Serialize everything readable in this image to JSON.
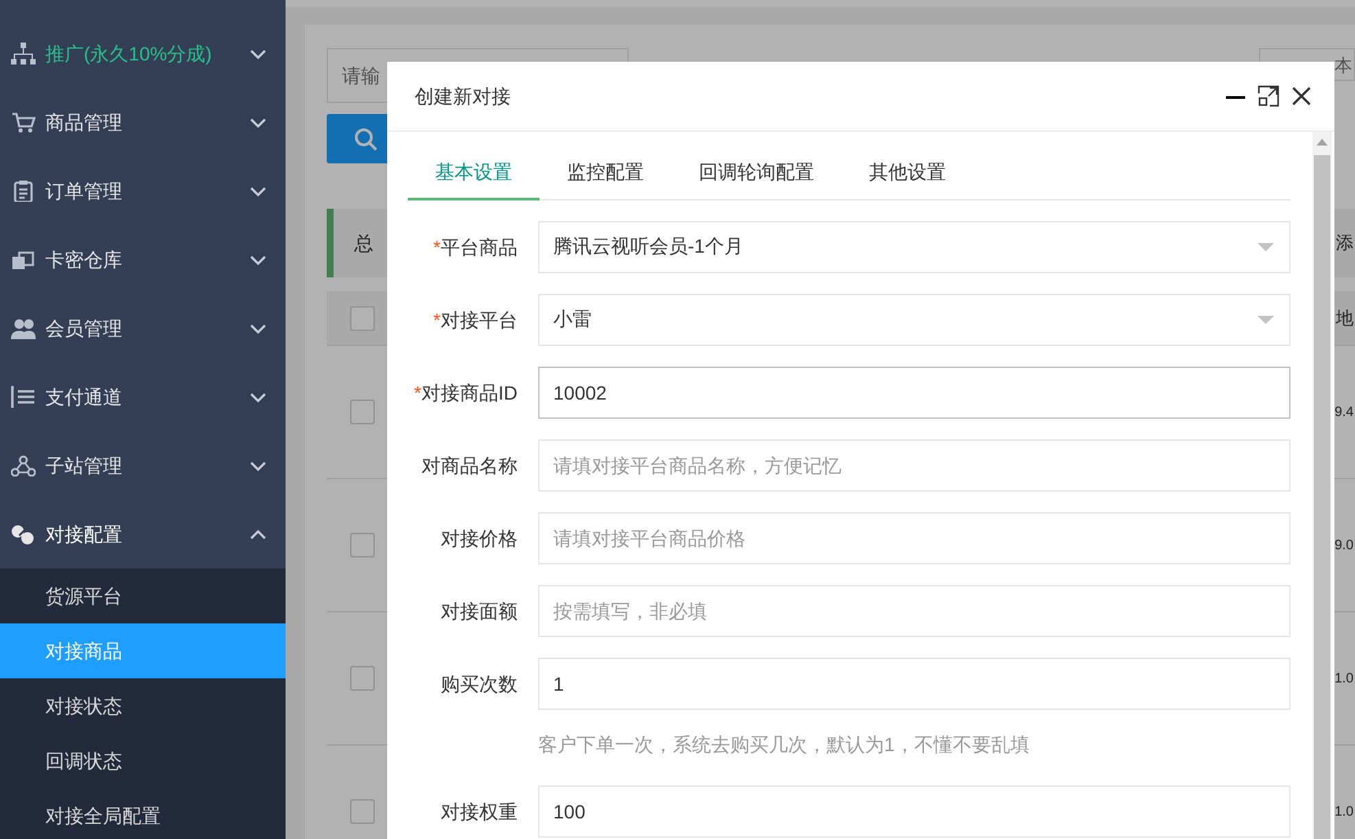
{
  "sidebar": {
    "items": [
      {
        "label": "推广(永久10%分成)",
        "kind": "promo",
        "expanded": false
      },
      {
        "label": "商品管理",
        "kind": "menu",
        "expanded": false
      },
      {
        "label": "订单管理",
        "kind": "menu",
        "expanded": false
      },
      {
        "label": "卡密仓库",
        "kind": "menu",
        "expanded": false
      },
      {
        "label": "会员管理",
        "kind": "menu",
        "expanded": false
      },
      {
        "label": "支付通道",
        "kind": "menu",
        "expanded": false
      },
      {
        "label": "子站管理",
        "kind": "menu",
        "expanded": false
      },
      {
        "label": "对接配置",
        "kind": "menu",
        "expanded": true,
        "children": [
          {
            "label": "货源平台",
            "selected": false
          },
          {
            "label": "对接商品",
            "selected": true
          },
          {
            "label": "对接状态",
            "selected": false
          },
          {
            "label": "回调状态",
            "selected": false
          },
          {
            "label": "对接全局配置",
            "selected": false
          }
        ]
      }
    ]
  },
  "background": {
    "search": {
      "placeholder": "请输"
    },
    "filter": {
      "placeholder": "本"
    },
    "notice": "总",
    "notice_right": "添",
    "table": {
      "header": {
        "checked": false,
        "text": "地"
      },
      "rows": [
        {
          "checked": false,
          "text": "9.4"
        },
        {
          "checked": false,
          "text": "9.0"
        },
        {
          "checked": false,
          "text": "1.0"
        },
        {
          "checked": false,
          "text": "1.0"
        }
      ]
    }
  },
  "modal": {
    "title": "创建新对接",
    "tabs": [
      {
        "label": "基本设置",
        "selected": true
      },
      {
        "label": "监控配置",
        "selected": false
      },
      {
        "label": "回调轮询配置",
        "selected": false
      },
      {
        "label": "其他设置",
        "selected": false
      }
    ],
    "fields": [
      {
        "label": "平台商品",
        "required_mark": "*",
        "kind": "select",
        "value": "腾讯云视听会员-1个月",
        "focused": false
      },
      {
        "label": "对接平台",
        "required_mark": "*",
        "kind": "select",
        "value": "小雷",
        "focused": false
      },
      {
        "label": "对接商品ID",
        "required_mark": "*",
        "kind": "input",
        "value": "10002",
        "focused": true
      },
      {
        "label": "对商品名称",
        "kind": "input",
        "placeholder": "请填对接平台商品名称，方便记忆",
        "focused": false
      },
      {
        "label": "对接价格",
        "kind": "input",
        "placeholder": "请填对接平台商品价格",
        "focused": false
      },
      {
        "label": "对接面额",
        "kind": "input",
        "placeholder": "按需填写，非必填",
        "focused": false
      },
      {
        "label": "购买次数",
        "kind": "input",
        "value": "1",
        "help": "客户下单一次，系统去购买几次，默认为1，不懂不要乱填",
        "focused": false
      },
      {
        "label": "对接权重",
        "kind": "input",
        "value": "100",
        "focused": false
      }
    ]
  }
}
